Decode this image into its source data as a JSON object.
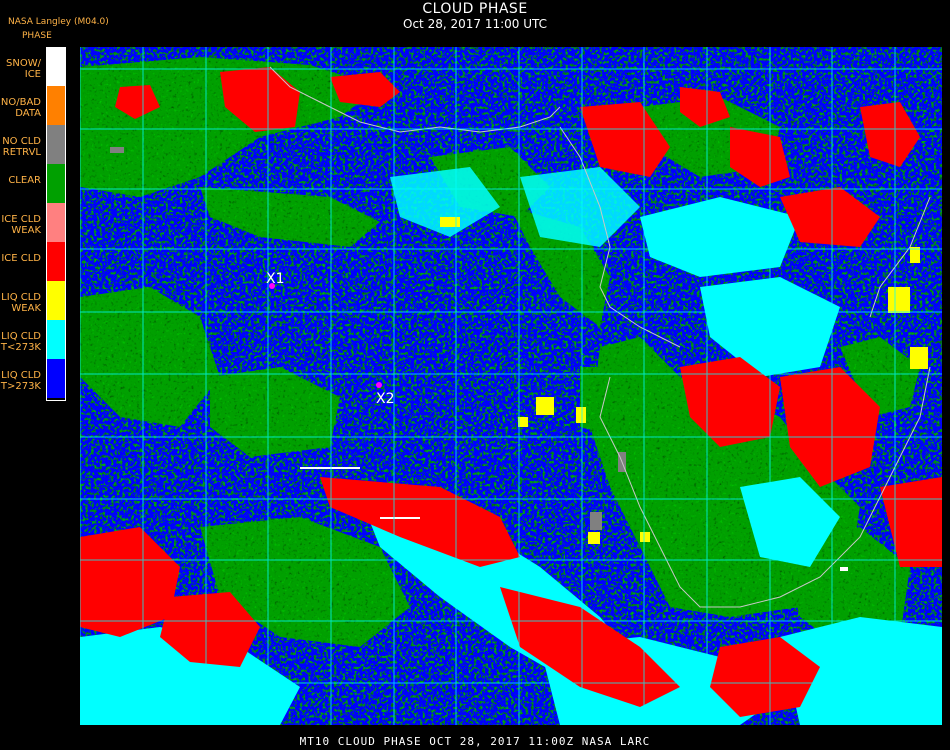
{
  "header": {
    "title": "CLOUD PHASE",
    "subtitle": "Oct 28, 2017 11:00 UTC",
    "producer": "NASA Langley (M04.0)",
    "legend_title": "PHASE"
  },
  "legend": [
    {
      "label": "SNOW/\nICE",
      "color": "#ffffff"
    },
    {
      "label": "NO/BAD\nDATA",
      "color": "#ff8000"
    },
    {
      "label": "NO CLD\nRETRVL",
      "color": "#808080"
    },
    {
      "label": "CLEAR",
      "color": "#00a000"
    },
    {
      "label": "ICE CLD\nWEAK",
      "color": "#ff8080"
    },
    {
      "label": "ICE CLD",
      "color": "#ff0000"
    },
    {
      "label": "LIQ CLD\nWEAK",
      "color": "#ffff00"
    },
    {
      "label": "LIQ CLD\nT<273K",
      "color": "#00ffff"
    },
    {
      "label": "LIQ CLD\nT>273K",
      "color": "#0000ff"
    }
  ],
  "markers": [
    {
      "label": "X1",
      "color": "#ff00ff"
    },
    {
      "label": "X2",
      "color": "#ff00ff"
    }
  ],
  "footer": "MT10  CLOUD PHASE   OCT 28, 2017 11:00Z   NASA LARC",
  "colors": {
    "background": "#000000",
    "gridline": "#00ffff",
    "coastline": "#c8c8c8",
    "label_text": "#ffb347"
  }
}
